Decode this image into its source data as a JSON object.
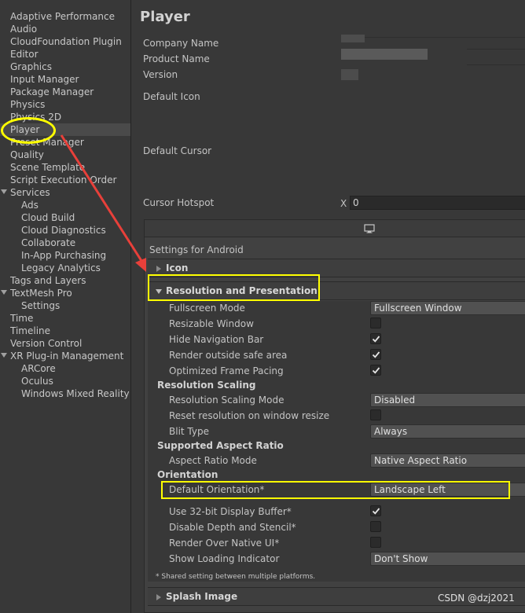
{
  "sidebar": {
    "items": [
      {
        "label": "Adaptive Performance",
        "level": 0
      },
      {
        "label": "Audio",
        "level": 0
      },
      {
        "label": "CloudFoundation Plugin",
        "level": 0
      },
      {
        "label": "Editor",
        "level": 0
      },
      {
        "label": "Graphics",
        "level": 0
      },
      {
        "label": "Input Manager",
        "level": 0
      },
      {
        "label": "Package Manager",
        "level": 0
      },
      {
        "label": "Physics",
        "level": 0
      },
      {
        "label": "Physics 2D",
        "level": 0
      },
      {
        "label": "Player",
        "level": 0,
        "selected": true
      },
      {
        "label": "Preset Manager",
        "level": 0
      },
      {
        "label": "Quality",
        "level": 0
      },
      {
        "label": "Scene Template",
        "level": 0
      },
      {
        "label": "Script Execution Order",
        "level": 0
      },
      {
        "label": "Services",
        "level": 0,
        "expanded": true
      },
      {
        "label": "Ads",
        "level": 1
      },
      {
        "label": "Cloud Build",
        "level": 1
      },
      {
        "label": "Cloud Diagnostics",
        "level": 1
      },
      {
        "label": "Collaborate",
        "level": 1
      },
      {
        "label": "In-App Purchasing",
        "level": 1
      },
      {
        "label": "Legacy Analytics",
        "level": 1
      },
      {
        "label": "Tags and Layers",
        "level": 0
      },
      {
        "label": "TextMesh Pro",
        "level": 0,
        "expanded": true
      },
      {
        "label": "Settings",
        "level": 1
      },
      {
        "label": "Time",
        "level": 0
      },
      {
        "label": "Timeline",
        "level": 0
      },
      {
        "label": "Version Control",
        "level": 0
      },
      {
        "label": "XR Plug-in Management",
        "level": 0,
        "expanded": true
      },
      {
        "label": "ARCore",
        "level": 1
      },
      {
        "label": "Oculus",
        "level": 1
      },
      {
        "label": "Windows Mixed Reality",
        "level": 1
      }
    ]
  },
  "header": {
    "title": "Player",
    "company_name_label": "Company Name",
    "product_name_label": "Product Name",
    "version_label": "Version",
    "default_icon_label": "Default Icon",
    "default_cursor_label": "Default Cursor",
    "cursor_hotspot_label": "Cursor Hotspot",
    "cursor_hotspot_x_label": "X",
    "cursor_hotspot_x_value": "0"
  },
  "platform": {
    "icon": "monitor-icon",
    "settings_for": "Settings for Android"
  },
  "sections": {
    "icon": "Icon",
    "resolution": "Resolution and Presentation",
    "splash": "Splash Image"
  },
  "resolution": {
    "fullscreen_mode_label": "Fullscreen Mode",
    "fullscreen_mode_value": "Fullscreen Window",
    "resizable_window_label": "Resizable Window",
    "hide_nav_bar_label": "Hide Navigation Bar",
    "render_outside_safe_label": "Render outside safe area",
    "optimized_frame_pacing_label": "Optimized Frame Pacing",
    "resolution_scaling_heading": "Resolution Scaling",
    "resolution_scaling_mode_label": "Resolution Scaling Mode",
    "resolution_scaling_mode_value": "Disabled",
    "reset_resolution_label": "Reset resolution on window resize",
    "blit_type_label": "Blit Type",
    "blit_type_value": "Always",
    "supported_aspect_heading": "Supported Aspect Ratio",
    "aspect_ratio_mode_label": "Aspect Ratio Mode",
    "aspect_ratio_mode_value": "Native Aspect Ratio",
    "orientation_heading": "Orientation",
    "default_orientation_label": "Default Orientation*",
    "default_orientation_value": "Landscape Left",
    "use_32bit_label": "Use 32-bit Display Buffer*",
    "disable_depth_label": "Disable Depth and Stencil*",
    "render_over_native_label": "Render Over Native UI*",
    "show_loading_label": "Show Loading Indicator",
    "show_loading_value": "Don't Show",
    "footnote": "* Shared setting between multiple platforms."
  },
  "checkboxes": {
    "resizable_window": false,
    "hide_nav_bar": true,
    "render_outside_safe": true,
    "optimized_frame_pacing": true,
    "reset_resolution": false,
    "use_32bit": true,
    "disable_depth": false,
    "render_over_native": false
  },
  "annotation_color": "#ffff00",
  "arrow_color": "#e8403a",
  "watermark": "CSDN @dzj2021"
}
